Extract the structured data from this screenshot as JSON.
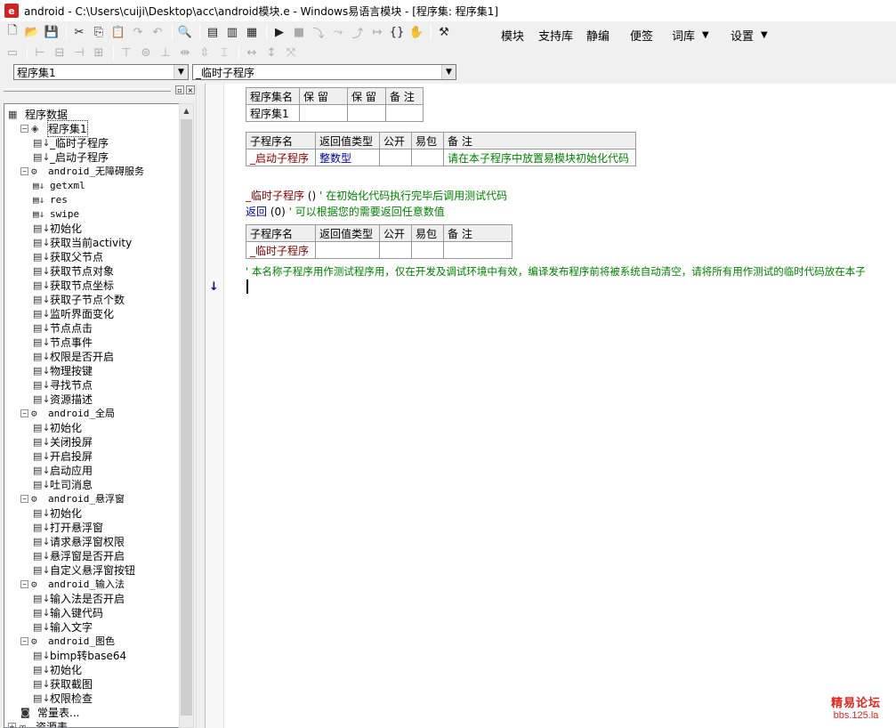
{
  "window": {
    "title": "android - C:\\Users\\cuiji\\Desktop\\acc\\android模块.e - Windows易语言模块 - [程序集: 程序集1]"
  },
  "menu": {
    "items": [
      "模块",
      "支持库",
      "静编",
      "便签",
      "词库",
      "设置"
    ]
  },
  "combos": {
    "left": "程序集1",
    "right": "_临时子程序"
  },
  "tree": {
    "root": "程序数据",
    "assembly1": {
      "label": "程序集1",
      "children": [
        "_临时子程序",
        "_启动子程序"
      ]
    },
    "groups": [
      {
        "label": "android_无障碍服务",
        "children": [
          "getxml",
          "res",
          "swipe",
          "初始化",
          "获取当前activity",
          "获取父节点",
          "获取节点对象",
          "获取节点坐标",
          "获取子节点个数",
          "监听界面变化",
          "节点点击",
          "节点事件",
          "权限是否开启",
          "物理按键",
          "寻找节点",
          "资源描述"
        ]
      },
      {
        "label": "android_全局",
        "children": [
          "初始化",
          "关闭投屏",
          "开启投屏",
          "启动应用",
          "吐司消息"
        ]
      },
      {
        "label": "android_悬浮窗",
        "children": [
          "初始化",
          "打开悬浮窗",
          "请求悬浮窗权限",
          "悬浮窗是否开启",
          "自定义悬浮窗按钮"
        ]
      },
      {
        "label": "android_输入法",
        "children": [
          "输入法是否开启",
          "输入键代码",
          "输入文字"
        ]
      },
      {
        "label": "android_图色",
        "children": [
          "bimp转base64",
          "初始化",
          "获取截图",
          "权限检查"
        ]
      }
    ],
    "const_table": "常量表...",
    "res_table": "资源表"
  },
  "editor": {
    "assembly_table": {
      "headers": [
        "程序集名",
        "保 留",
        "保 留",
        "备 注"
      ],
      "row": [
        "程序集1",
        "",
        "",
        ""
      ]
    },
    "sub1_table": {
      "headers": [
        "子程序名",
        "返回值类型",
        "公开",
        "易包",
        "备 注"
      ],
      "row": [
        "_启动子程序",
        "整数型",
        "",
        "",
        "请在本子程序中放置易模块初始化代码"
      ]
    },
    "code_line1": {
      "name": "_临时子程序",
      "parens": " ()",
      "comment": "  ' 在初始化代码执行完毕后调用测试代码"
    },
    "code_line2": {
      "keyword": "返回",
      "arg": " (0)",
      "comment": "  ' 可以根据您的需要返回任意数值"
    },
    "sub2_table": {
      "headers": [
        "子程序名",
        "返回值类型",
        "公开",
        "易包",
        "备 注"
      ],
      "row": [
        "_临时子程序",
        "",
        "",
        "",
        ""
      ]
    },
    "long_comment": "' 本名称子程序用作测试程序用，仅在开发及调试环境中有效，编译发布程序前将被系统自动清空，请将所有用作测试的临时代码放在本子"
  },
  "watermark": {
    "line1": "精易论坛",
    "line2": "bbs.125.la"
  }
}
